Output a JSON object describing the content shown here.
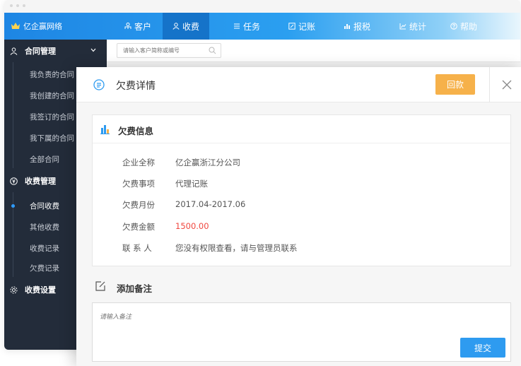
{
  "brand": {
    "name": "亿企赢网络"
  },
  "nav": [
    {
      "label": "客户",
      "icon": "customers-icon"
    },
    {
      "label": "收费",
      "icon": "user-icon",
      "active": true
    },
    {
      "label": "任务",
      "icon": "list-icon"
    },
    {
      "label": "记账",
      "icon": "edit-icon"
    },
    {
      "label": "报税",
      "icon": "chart-bar-icon"
    },
    {
      "label": "统计",
      "icon": "line-chart-icon"
    },
    {
      "label": "帮助",
      "icon": "help-icon"
    }
  ],
  "sidebar": {
    "groups": [
      {
        "label": "合同管理",
        "icon": "user-icon",
        "items": [
          "我负责的合同",
          "我创建的合同",
          "我签订的合同",
          "我下属的合同",
          "全部合同"
        ]
      },
      {
        "label": "收费管理",
        "icon": "yen-icon",
        "items": [
          "合同收费",
          "其他收费",
          "收费记录",
          "欠费记录"
        ],
        "active_item": "合同收费"
      },
      {
        "label": "收费设置",
        "icon": "settings-icon",
        "items": []
      }
    ]
  },
  "search": {
    "placeholder": "请输入客户简称或编号"
  },
  "modal": {
    "title": "欠费详情",
    "refund_label": "回款",
    "info": {
      "title": "欠费信息",
      "fields": [
        {
          "label": "企业全称",
          "value": "亿企赢浙江分公司"
        },
        {
          "label": "欠费事项",
          "value": "代理记账"
        },
        {
          "label": "欠费月份",
          "value": "2017.04-2017.06"
        },
        {
          "label": "欠费金额",
          "value": "1500.00"
        },
        {
          "label": "联 系 人",
          "value": "您没有权限查看，请与管理员联系"
        }
      ]
    },
    "remark": {
      "title": "添加备注",
      "placeholder": "请输入备注",
      "submit_label": "提交"
    }
  },
  "colors": {
    "primary": "#2e9bf0",
    "refund": "#f6b14a",
    "amount": "#f0473f",
    "sidebar_bg": "#232c3a"
  }
}
